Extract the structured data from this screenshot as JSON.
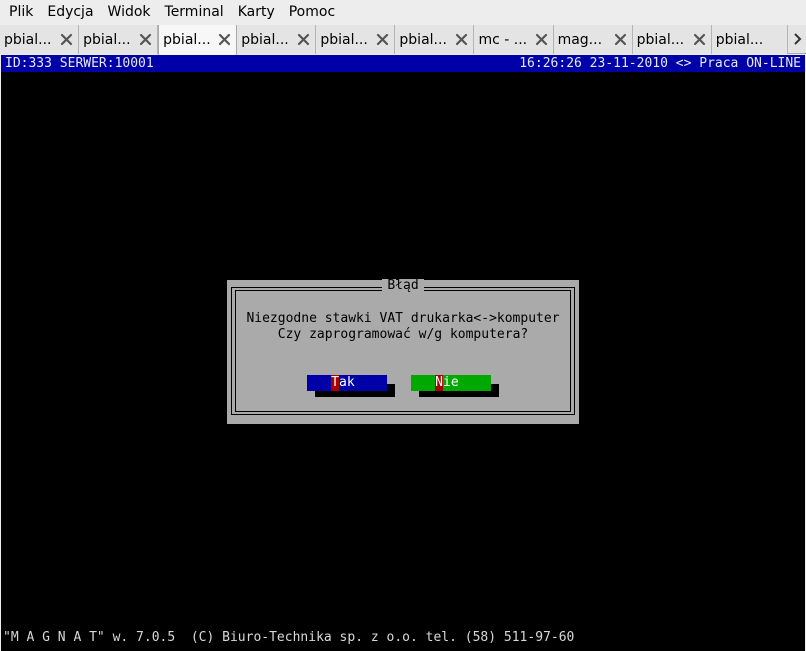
{
  "menubar": {
    "items": [
      "Plik",
      "Edycja",
      "Widok",
      "Terminal",
      "Karty",
      "Pomoc"
    ]
  },
  "tabs": [
    {
      "label": "pbial...",
      "active": false
    },
    {
      "label": "pbial...",
      "active": false
    },
    {
      "label": "pbial...",
      "active": true
    },
    {
      "label": "pbial...",
      "active": false
    },
    {
      "label": "pbial...",
      "active": false
    },
    {
      "label": "pbial...",
      "active": false
    },
    {
      "label": "mc - ...",
      "active": false
    },
    {
      "label": "mag...",
      "active": false
    },
    {
      "label": "pbial...",
      "active": false
    },
    {
      "label": "pbial...",
      "active": false
    }
  ],
  "terminal": {
    "status_left": "ID:333 SERWER:10001",
    "status_right": "16:26:26 23-11-2010 <> Praca ON-LINE",
    "dialog": {
      "title": "Błąd",
      "line1": "Niezgodne stawki VAT drukarka<->komputer",
      "line2": "Czy zaprogramować w/g komputera?",
      "yes_hotkey": "T",
      "yes_rest": "ak",
      "no_hotkey": "N",
      "no_rest": "ie"
    },
    "footer": "\"M A G N A T\" w. 7.0.5  (C) Biuro-Technika sp. z o.o. tel. (58) 511-97-60"
  },
  "colors": {
    "status_bg": "#0000a8",
    "dialog_bg": "#aaaaaa",
    "yes_button": "#0000a8",
    "no_button": "#00a800",
    "hotkey": "#a80000"
  }
}
